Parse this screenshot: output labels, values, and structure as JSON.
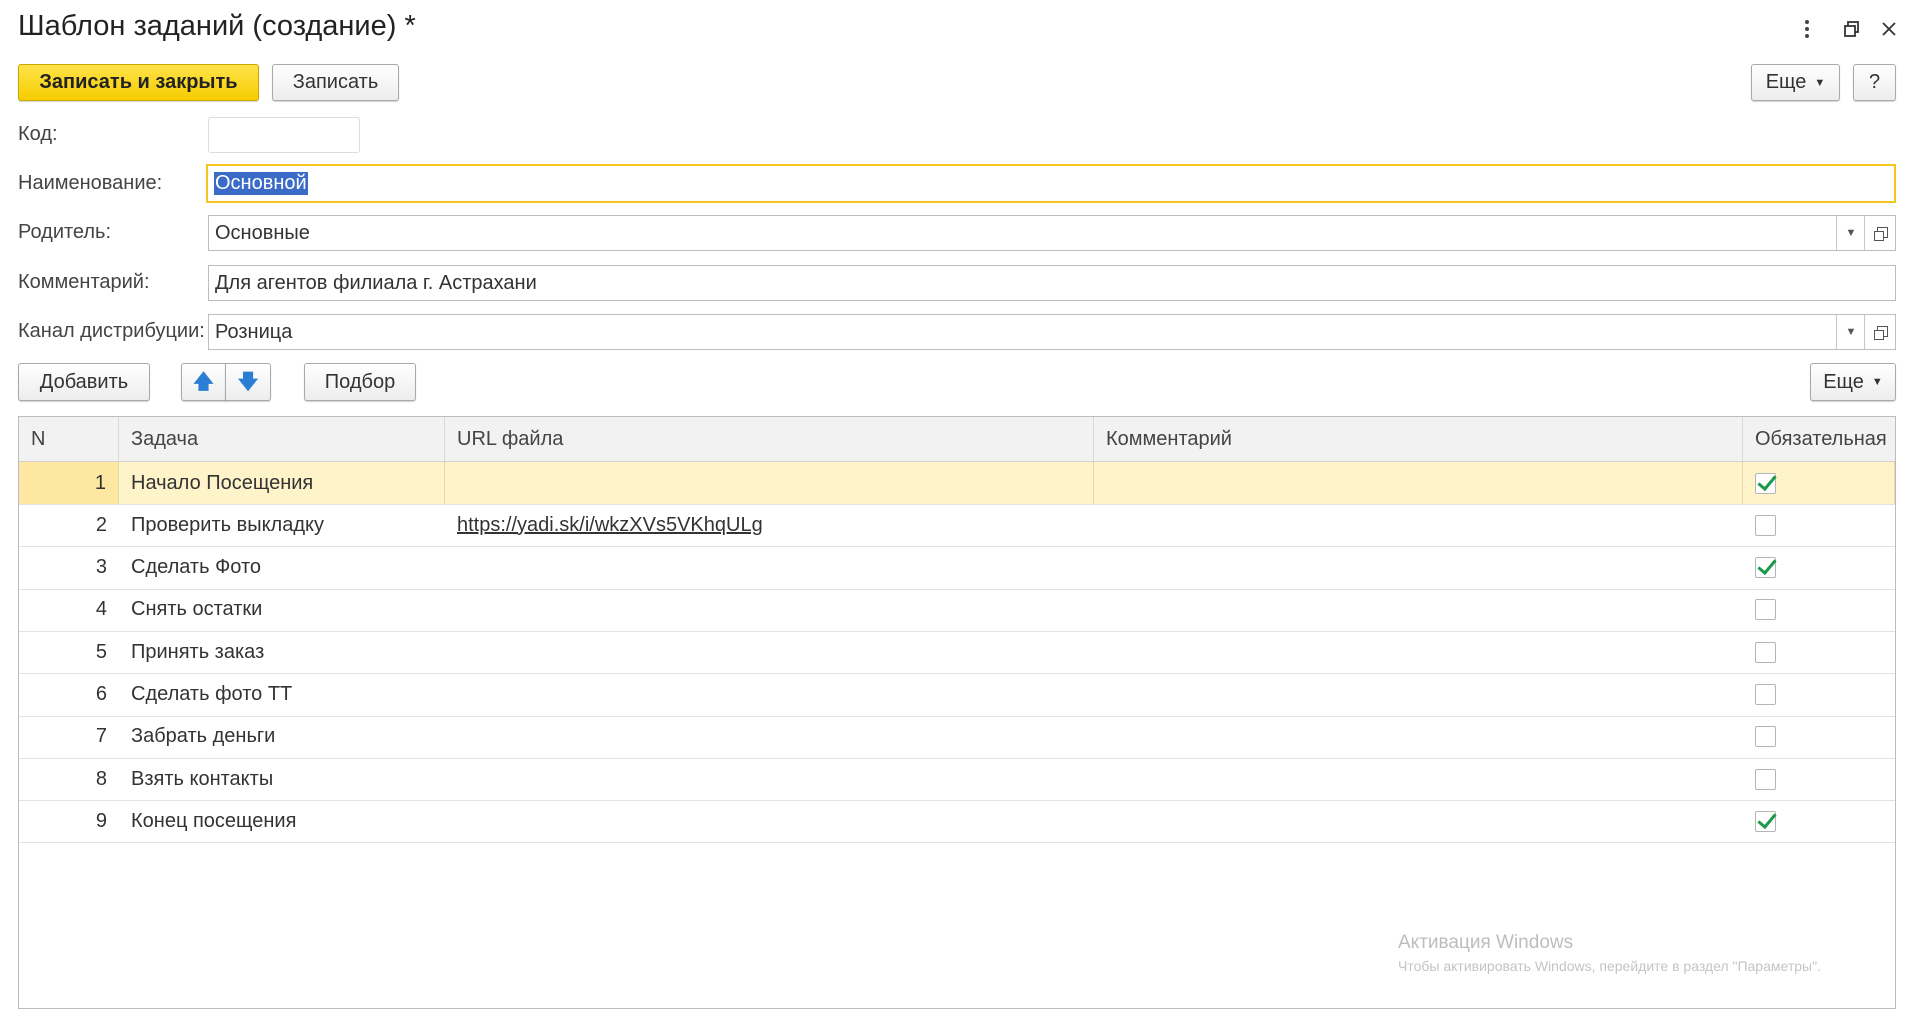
{
  "window": {
    "title": "Шаблон заданий (создание) *",
    "menu_icon": "kebab-menu-icon",
    "restore_icon": "restore-window-icon",
    "close_icon": "close-icon"
  },
  "toolbar": {
    "save_close_label": "Записать и закрыть",
    "save_label": "Записать",
    "more_label": "Еще",
    "help_label": "?"
  },
  "form": {
    "code": {
      "label": "Код:",
      "value": ""
    },
    "name": {
      "label": "Наименование:",
      "value": "Основной"
    },
    "parent": {
      "label": "Родитель:",
      "value": "Основные"
    },
    "comment": {
      "label": "Комментарий:",
      "value": "Для агентов филиала г. Астрахани"
    },
    "channel": {
      "label": "Канал дистрибуции:",
      "value": "Розница"
    }
  },
  "table_toolbar": {
    "add_label": "Добавить",
    "up_icon": "arrow-up-icon",
    "down_icon": "arrow-down-icon",
    "pick_label": "Подбор",
    "more_label": "Еще"
  },
  "table": {
    "columns": [
      "N",
      "Задача",
      "URL файла",
      "Комментарий",
      "Обязательная"
    ],
    "rows": [
      {
        "n": "1",
        "task": "Начало Посещения",
        "url": "",
        "comment": "",
        "required": true
      },
      {
        "n": "2",
        "task": "Проверить выкладку",
        "url": "https://yadi.sk/i/wkzXVs5VKhqULg",
        "comment": "",
        "required": false
      },
      {
        "n": "3",
        "task": "Сделать Фото",
        "url": "",
        "comment": "",
        "required": true
      },
      {
        "n": "4",
        "task": "Снять остатки",
        "url": "",
        "comment": "",
        "required": false
      },
      {
        "n": "5",
        "task": "Принять заказ",
        "url": "",
        "comment": "",
        "required": false
      },
      {
        "n": "6",
        "task": "Сделать фото ТТ",
        "url": "",
        "comment": "",
        "required": false
      },
      {
        "n": "7",
        "task": "Забрать деньги",
        "url": "",
        "comment": "",
        "required": false
      },
      {
        "n": "8",
        "task": "Взять контакты",
        "url": "",
        "comment": "",
        "required": false
      },
      {
        "n": "9",
        "task": "Конец посещения",
        "url": "",
        "comment": "",
        "required": true
      }
    ],
    "selected_row": 0
  },
  "watermark": {
    "title": "Активация Windows",
    "subtitle": "Чтобы активировать Windows, перейдите в раздел \"Параметры\"."
  },
  "colors": {
    "primary_button": "#f5cc00",
    "focus_border": "#f3c720",
    "selected_row": "#fff3c9",
    "check_green": "#1c9a4b",
    "arrow_blue": "#2a7fd4"
  }
}
